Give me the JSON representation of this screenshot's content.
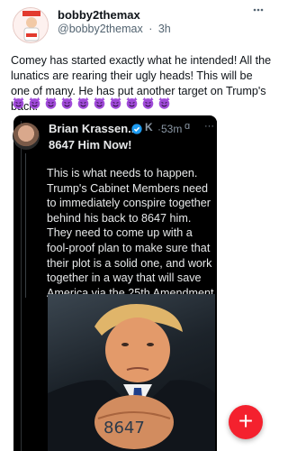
{
  "post": {
    "display_name": "bobby2themax",
    "handle": "@bobby2themax",
    "separator": "·",
    "time_ago": "3h",
    "more_label": "⋮",
    "text": "Comey has started exactly what he intended! All the lunatics are rearing their ugly heads! This will be one of many. He has put another target on Trump's back!",
    "emoji_count": 10,
    "emoji_icon": "smiling-imp-emoji"
  },
  "embed": {
    "name": "Brian Krassen...",
    "verified_icon": "verified-badge-icon",
    "k_icon": "K",
    "time_ago": "53m",
    "mini_icon": "ɑ",
    "dots": "···",
    "handle": "8647 Him Now!",
    "text": "This is what needs to happen. Trump's Cabinet Members need to immediately conspire together behind his back to 8647 him. They need to come up with a fool-proof plan to make sure that their plot is a solid one, and work together in a way that will save America via the 25th Amendment",
    "photo_caption_digits": "8647"
  },
  "fab": {
    "label": "+"
  },
  "colors": {
    "accent": "#f4212e",
    "verified": "#1d9bf0",
    "emoji": "#a04bd9"
  }
}
